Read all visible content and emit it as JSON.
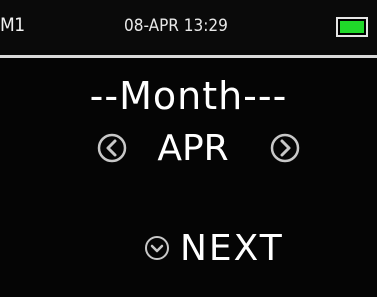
{
  "status_bar": {
    "profile": "M1",
    "datetime": "08-APR 13:29",
    "battery_icon": "battery-full-icon",
    "battery_color": "#20d82a"
  },
  "screen": {
    "title": "--Month---",
    "value": "APR",
    "prev_icon": "chevron-left-circle-icon",
    "next_icon": "chevron-right-circle-icon",
    "next_button": {
      "label": "NEXT",
      "icon": "chevron-down-circle-icon"
    }
  },
  "colors": {
    "background": "#050505",
    "text": "#ffffff",
    "divider": "#d9d9d9"
  }
}
